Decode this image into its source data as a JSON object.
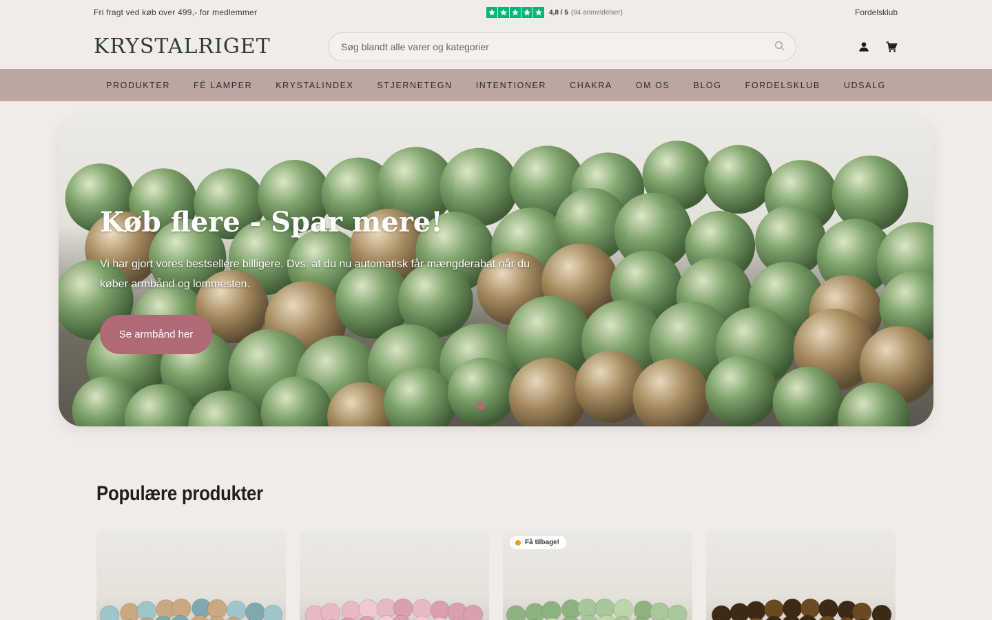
{
  "topbar": {
    "shipping_note": "Fri fragt ved køb over 499,- for medlemmer",
    "rating_score": "4,8 / 5",
    "rating_count": "(94 anmeldelser)",
    "member_link": "Fordelsklub",
    "star_color": "#00b67a"
  },
  "header": {
    "logo_text": "KRYSTALRIGET",
    "search_placeholder": "Søg blandt alle varer og kategorier"
  },
  "nav": {
    "items": [
      "PRODUKTER",
      "FÉ LAMPER",
      "KRYSTALINDEX",
      "STJERNETEGN",
      "INTENTIONER",
      "CHAKRA",
      "OM OS",
      "BLOG",
      "FORDELSKLUB",
      "UDSALG"
    ]
  },
  "hero": {
    "title": "Køb flere - Spar mere!",
    "text": "Vi har gjort vores bestsellere billigere. Dvs. at du nu automatisk får mængderabat når du køber armbånd og lommesten.",
    "cta_label": "Se armbånd her",
    "accent_color": "#b06a75"
  },
  "popular": {
    "title": "Populære produkter",
    "products": [
      {
        "badge": "",
        "bead_colors": [
          "#9fc4c9",
          "#c9a882",
          "#7fa9b0"
        ]
      },
      {
        "badge": "",
        "bead_colors": [
          "#e8b8c4",
          "#f0c9d2",
          "#d9a0b0"
        ]
      },
      {
        "badge": "Få tilbage!",
        "bead_colors": [
          "#a8c79a",
          "#bcd6a8",
          "#8fb380"
        ]
      },
      {
        "badge": "",
        "bead_colors": [
          "#6b4a22",
          "#9a6a2e",
          "#3c2a16"
        ]
      }
    ]
  }
}
